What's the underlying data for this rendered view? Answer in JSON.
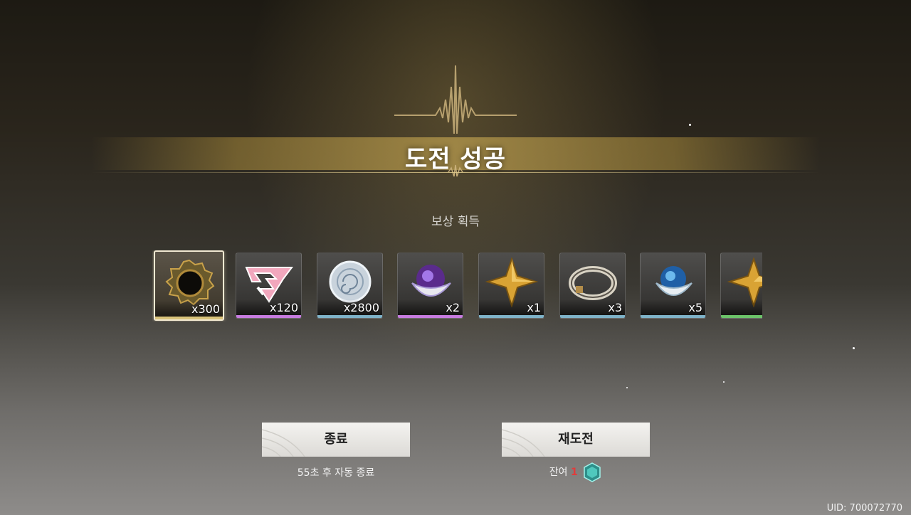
{
  "title": "도전 성공",
  "subtitle": "보상 획득",
  "rewards": [
    {
      "icon": "dark-ring-icon",
      "qty": "x300",
      "rarity_color": "#d9c37a"
    },
    {
      "icon": "pink-crystal-icon",
      "qty": "x120",
      "rarity_color": "#c77ce0"
    },
    {
      "icon": "silver-orb-icon",
      "qty": "x2800",
      "rarity_color": "#7fb3c9"
    },
    {
      "icon": "purple-capsule-icon",
      "qty": "x2",
      "rarity_color": "#c77ce0"
    },
    {
      "icon": "gold-star-icon",
      "qty": "x1",
      "rarity_color": "#7fb3c9"
    },
    {
      "icon": "silver-band-icon",
      "qty": "x3",
      "rarity_color": "#7fb3c9"
    },
    {
      "icon": "blue-capsule-icon",
      "qty": "x5",
      "rarity_color": "#7fb3c9"
    },
    {
      "icon": "gold-star-icon",
      "qty": "",
      "rarity_color": "#6cc36a"
    }
  ],
  "buttons": {
    "exit_label": "종료",
    "retry_label": "재도전"
  },
  "auto_exit_text": "55초 후 자동 종료",
  "remaining": {
    "label": "잔여",
    "count": "1",
    "icon": "teal-gem-icon"
  },
  "uid": "UID: 700072770"
}
